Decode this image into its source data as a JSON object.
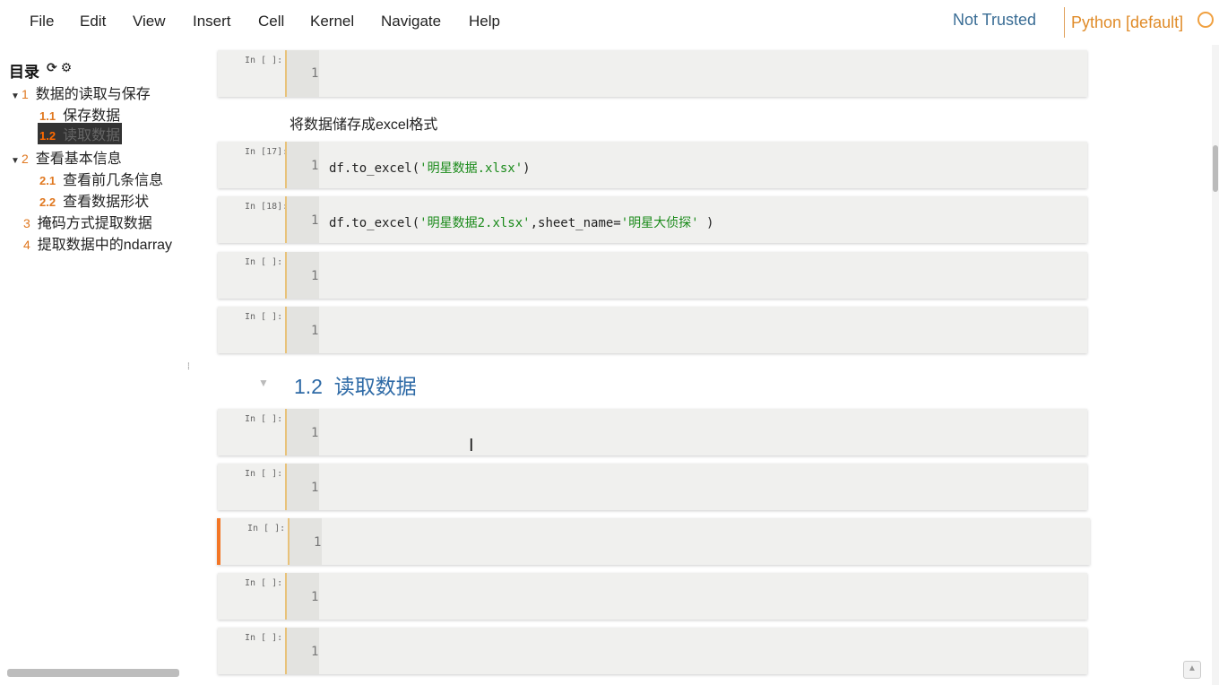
{
  "menubar": {
    "items": [
      "File",
      "Edit",
      "View",
      "Insert",
      "Cell",
      "Kernel",
      "Navigate",
      "Help"
    ],
    "not_trusted": "Not Trusted",
    "kernel": "Python [default]"
  },
  "toc": {
    "title": "目录",
    "tools": "⟳ ⚙",
    "items": [
      {
        "num": "1",
        "label": "数据的读取与保存"
      },
      {
        "num": "1.1",
        "label": "保存数据"
      },
      {
        "num": "1.2",
        "label": "读取数据"
      },
      {
        "num": "2",
        "label": "查看基本信息"
      },
      {
        "num": "2.1",
        "label": "查看前几条信息"
      },
      {
        "num": "2.2",
        "label": "查看数据形状"
      },
      {
        "num": "3",
        "label": "掩码方式提取数据"
      },
      {
        "num": "4",
        "label": "提取数据中的ndarray"
      }
    ]
  },
  "cells": [
    {
      "prompt": "In [ ]:",
      "line": "1"
    },
    {
      "markdown": "将数据储存成excel格式"
    },
    {
      "prompt": "In [17]:",
      "line": "1",
      "code_pre": "df.to_excel(",
      "code_str": "'明星数据.xlsx'",
      "code_post": ")"
    },
    {
      "prompt": "In [18]:",
      "line": "1",
      "code_pre": "df.to_excel(",
      "code_str": "'明星数据2.xlsx'",
      "code_mid": ",sheet_name=",
      "code_str2": "'明星大侦探'",
      "code_post": " )"
    },
    {
      "prompt": "In [ ]:",
      "line": "1"
    },
    {
      "prompt": "In [ ]:",
      "line": "1"
    },
    {
      "heading_num": "1.2",
      "heading_text": "读取数据"
    },
    {
      "prompt": "In [ ]:",
      "line": "1"
    },
    {
      "prompt": "In [ ]:",
      "line": "1"
    },
    {
      "prompt": "In [ ]:",
      "line": "1"
    },
    {
      "prompt": "In [ ]:",
      "line": "1"
    },
    {
      "prompt": "In [ ]:",
      "line": "1"
    }
  ]
}
